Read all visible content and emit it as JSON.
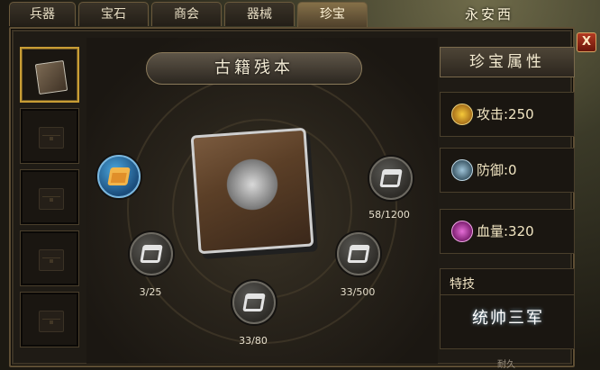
{
  "tabs": [
    {
      "label": "兵器",
      "active": false
    },
    {
      "label": "宝石",
      "active": false
    },
    {
      "label": "商会",
      "active": false
    },
    {
      "label": "器械",
      "active": false
    },
    {
      "label": "珍宝",
      "active": true
    }
  ],
  "city_name": "永安西",
  "close_label": "X",
  "item": {
    "name": "古籍残本"
  },
  "slots": [
    {
      "state": "selected"
    },
    {
      "state": "empty"
    },
    {
      "state": "empty"
    },
    {
      "state": "empty"
    },
    {
      "state": "empty"
    }
  ],
  "materials": [
    {
      "name": "gem",
      "progress": ""
    },
    {
      "name": "top-right",
      "progress": "58/1200"
    },
    {
      "name": "left",
      "progress": "3/25"
    },
    {
      "name": "right",
      "progress": "33/500"
    },
    {
      "name": "bottom",
      "progress": "33/80"
    }
  ],
  "attributes": {
    "title": "珍宝属性",
    "attack": "攻击:250",
    "defense": "防御:0",
    "hp": "血量:320"
  },
  "skill": {
    "label": "特技",
    "name": "统帅三军"
  },
  "footer": {
    "durability": "耐久"
  }
}
